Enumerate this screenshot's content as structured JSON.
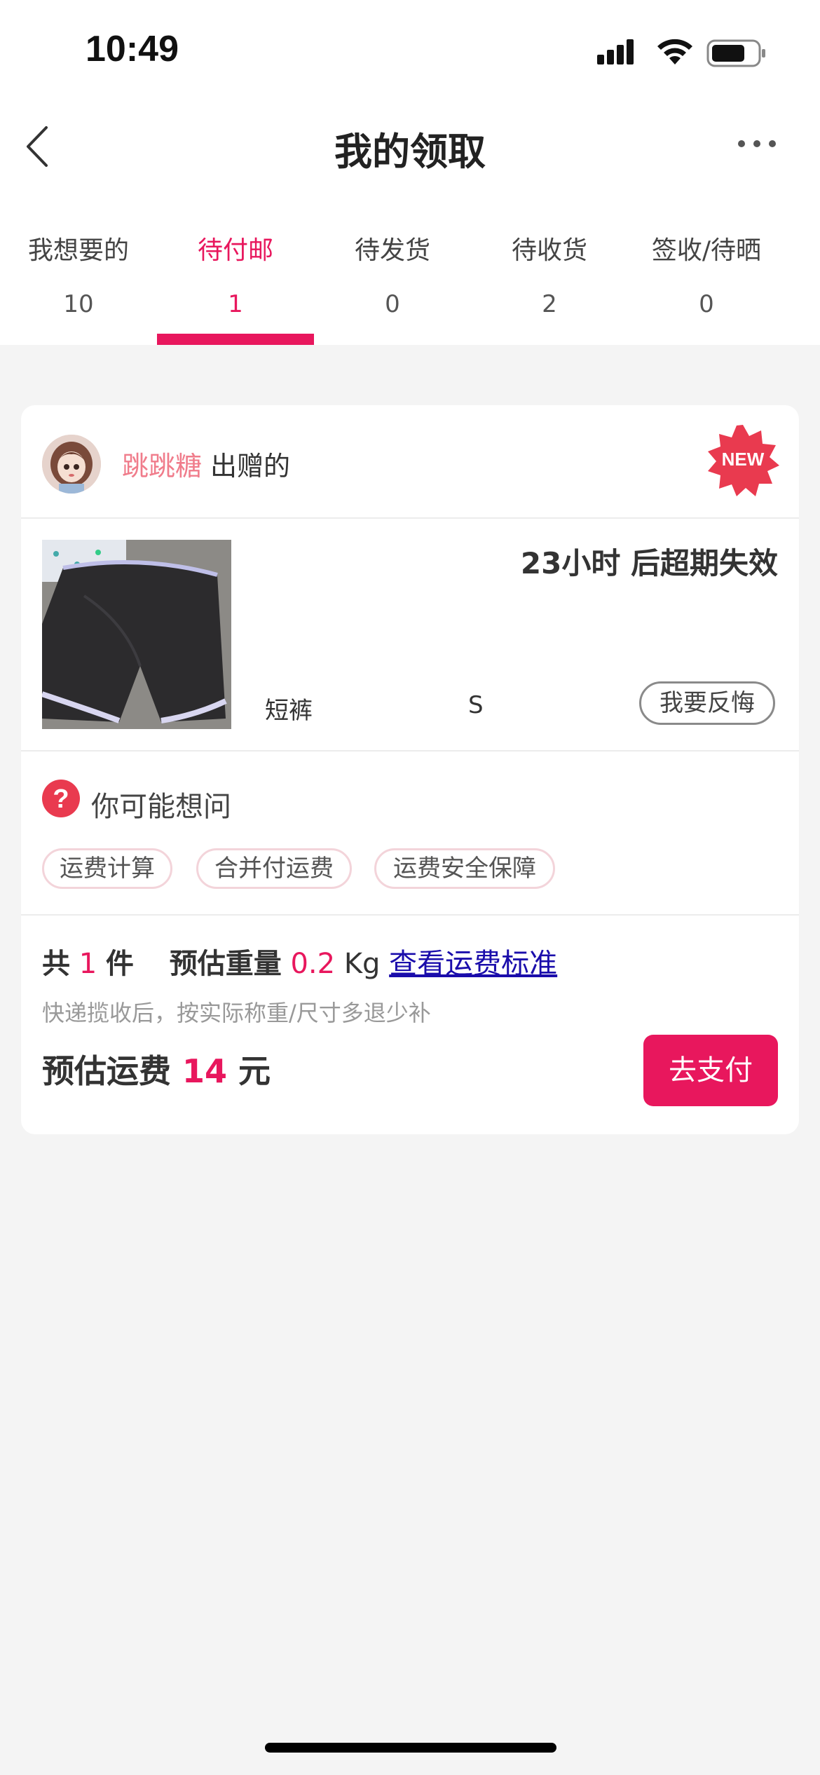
{
  "status_bar": {
    "time": "10:49",
    "icons": [
      "cellular-signal-icon",
      "wifi-icon",
      "battery-icon"
    ]
  },
  "nav": {
    "title": "我的领取",
    "back_icon": "chevron-left-icon",
    "more_icon": "more-horizontal-icon"
  },
  "tabs": [
    {
      "label": "我想要的",
      "count": "10",
      "active": false
    },
    {
      "label": "待付邮",
      "count": "1",
      "active": true
    },
    {
      "label": "待发货",
      "count": "0",
      "active": false
    },
    {
      "label": "待收货",
      "count": "2",
      "active": false
    },
    {
      "label": "签收/待晒",
      "count": "0",
      "active": false
    }
  ],
  "card": {
    "seller_name": "跳跳糖",
    "seller_suffix": "出赠的",
    "new_badge": "NEW",
    "expire_text": "23小时 后超期失效",
    "product_name": "短裤",
    "product_size": "S",
    "regret_button": "我要反悔",
    "faq_title": "你可能想问",
    "faq_chips": [
      "运费计算",
      "合并付运费",
      "运费安全保障"
    ],
    "summary": {
      "count_prefix": "共",
      "count": "1",
      "count_unit": "件",
      "weight_label": "预估重量",
      "weight": "0.2",
      "weight_unit": "Kg",
      "link": "查看运费标准",
      "note": "快递揽收后，按实际称重/尺寸多退少补",
      "fee_label": "预估运费",
      "fee": "14",
      "fee_unit": "元"
    },
    "pay_button": "去支付"
  },
  "colors": {
    "accent": "#e8175d",
    "seller_name": "#f07c8b",
    "link": "#1a0dab",
    "background": "#f4f4f4"
  }
}
